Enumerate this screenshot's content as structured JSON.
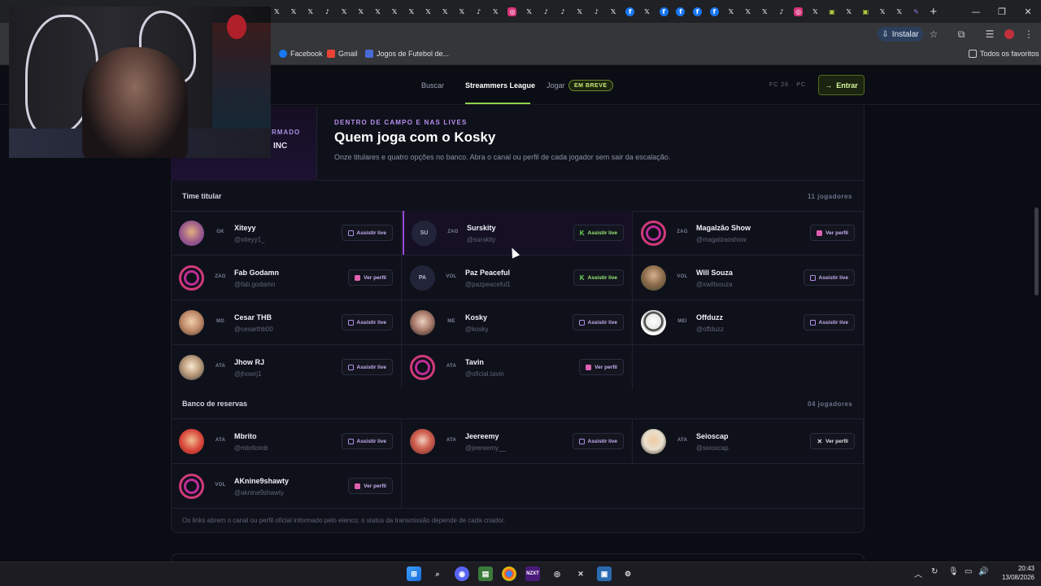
{
  "browser": {
    "install_label": "Instalar",
    "bookmarks": [
      {
        "label": "Facebook",
        "color": "#1877f2"
      },
      {
        "label": "Gmail",
        "color": "#ea4335"
      },
      {
        "label": "Jogos de Futebol de...",
        "color": "#4a6ad8"
      }
    ],
    "all_favorites_label": "Todos os favoritos",
    "tabs": [
      "x",
      "x",
      "x",
      "tiktok",
      "x",
      "x",
      "x",
      "x",
      "x",
      "x",
      "x",
      "x",
      "tiktok",
      "x",
      "instagram",
      "x",
      "tiktok",
      "tiktok",
      "x",
      "tiktok",
      "x",
      "facebook",
      "x",
      "facebook",
      "facebook",
      "facebook",
      "facebook",
      "x",
      "x",
      "x",
      "tiktok",
      "instagram",
      "x",
      "twitch",
      "x",
      "twitch",
      "x",
      "x",
      "pen"
    ]
  },
  "nav": {
    "search": "Buscar",
    "league": "Streammers League",
    "play": "Jogar",
    "soon_badge": "EM BREVE",
    "game_info": "FC 26 · PC",
    "enter_button": "Entrar"
  },
  "header": {
    "left_kicker": "RMADO",
    "left_name": "INC",
    "kicker": "DENTRO DE CAMPO E NAS LIVES",
    "title": "Quem joga com o Kosky",
    "subtitle": "Onze titulares e quatro opções no banco. Abra o canal ou perfil de cada jogador sem sair da escalação."
  },
  "starters": {
    "title": "Time titular",
    "count": "11 jogadores",
    "players": [
      {
        "name": "Xiteyy",
        "handle": "@xiteyy1_",
        "pos": "GK",
        "action": "Assistir live",
        "avatar": "face1",
        "icon": "live"
      },
      {
        "name": "Surskity",
        "handle": "@surskity",
        "pos": "ZAG",
        "action": "Assistir live",
        "avatar": "initials",
        "initials": "SU",
        "icon": "kick"
      },
      {
        "name": "Magalzão Show",
        "handle": "@magalzaoshow",
        "pos": "ZAG",
        "action": "Ver perfil",
        "avatar": "insta",
        "icon": "insta"
      },
      {
        "name": "Fab Godamn",
        "handle": "@fab.godamn",
        "pos": "ZAG",
        "action": "Ver perfil",
        "avatar": "insta",
        "icon": "insta"
      },
      {
        "name": "Paz Peaceful",
        "handle": "@pazpeaceful1",
        "pos": "VOL",
        "action": "Assistir live",
        "avatar": "initials",
        "initials": "PA",
        "icon": "kick"
      },
      {
        "name": "Will Souza",
        "handle": "@xwillsouza",
        "pos": "VOL",
        "action": "Assistir live",
        "avatar": "face4",
        "icon": "live"
      },
      {
        "name": "Cesar THB",
        "handle": "@cesarthb00",
        "pos": "MD",
        "action": "Assistir live",
        "avatar": "face2",
        "icon": "live"
      },
      {
        "name": "Kosky",
        "handle": "@kosky",
        "pos": "ME",
        "action": "Assistir live",
        "avatar": "face7",
        "icon": "live"
      },
      {
        "name": "Offduzz",
        "handle": "@offduzz",
        "pos": "MEI",
        "action": "Assistir live",
        "avatar": "face3",
        "icon": "live"
      },
      {
        "name": "Jhow RJ",
        "handle": "@jhowrj1",
        "pos": "ATA",
        "action": "Assistir live",
        "avatar": "face9",
        "icon": "live"
      },
      {
        "name": "Tavin",
        "handle": "@oficial.tavin",
        "pos": "ATA",
        "action": "Ver perfil",
        "avatar": "insta",
        "icon": "insta"
      }
    ]
  },
  "bench": {
    "title": "Banco de reservas",
    "count": "04 jogadores",
    "players": [
      {
        "name": "Mbrito",
        "handle": "@mbritomb",
        "pos": "ATA",
        "action": "Assistir live",
        "avatar": "face5",
        "icon": "live"
      },
      {
        "name": "Jeereemy",
        "handle": "@jeereemy__",
        "pos": "ATA",
        "action": "Assistir live",
        "avatar": "face6",
        "icon": "live"
      },
      {
        "name": "Seioscap",
        "handle": "@seioscap",
        "pos": "ATA",
        "action": "Ver perfil",
        "avatar": "face8",
        "icon": "x"
      },
      {
        "name": "AKnine9shawty",
        "handle": "@aknine9shawty",
        "pos": "VOL",
        "action": "Ver perfil",
        "avatar": "insta",
        "icon": "insta"
      }
    ]
  },
  "footnote": "Os links abrem o canal ou perfil oficial informado pelo elenco; o status da transmissão depende de cada criador.",
  "taskbar": {
    "time": "20:43",
    "date": "13/08/2026"
  }
}
